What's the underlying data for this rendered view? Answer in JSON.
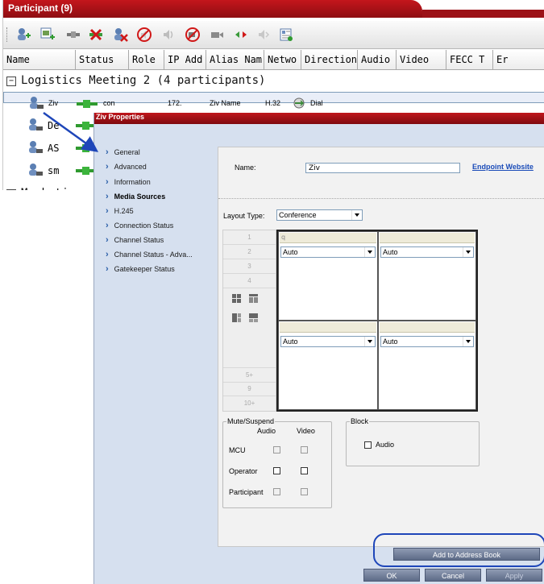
{
  "participant_panel": {
    "title": "Participant (9)",
    "toolbar_icons": [
      "add-participant-icon",
      "add-from-address-book-icon",
      "connect-icon",
      "disconnect-icon",
      "delete-participant-icon",
      "mute-audio-icon",
      "audio-icon",
      "block-video-icon",
      "video-icon",
      "suspend-icon",
      "speaker-icon",
      "properties-icon"
    ],
    "columns": [
      "Name",
      "Status",
      "Role",
      "IP Add",
      "Alias Nam",
      "Netwo",
      "Direction",
      "Audio",
      "Video",
      "FECC T",
      "Er"
    ],
    "groups": [
      {
        "toggle": "−",
        "label": "Logistics Meeting 2 (4 participants)"
      },
      {
        "toggle": "−",
        "label": "Marketing_"
      }
    ],
    "rows": [
      {
        "name": "Ziv",
        "role": "con",
        "ip": "172.",
        "alias": "Ziv Name",
        "network": "H.32",
        "direction": "Dial"
      },
      {
        "name": "De",
        "role": "",
        "ip": "",
        "alias": "",
        "network": "",
        "direction": ""
      },
      {
        "name": "AS",
        "role": "",
        "ip": "",
        "alias": "",
        "network": "",
        "direction": ""
      },
      {
        "name": "sm",
        "role": "",
        "ip": "",
        "alias": "",
        "network": "",
        "direction": ""
      }
    ]
  },
  "dialog": {
    "title": "Ziv Properties",
    "nav": [
      "General",
      "Advanced",
      "Information",
      "Media Sources",
      "H.245",
      "Connection Status",
      "Channel Status",
      "Channel Status - Adva...",
      "Gatekeeper Status"
    ],
    "active_nav": "Media Sources",
    "name_label": "Name:",
    "name_value": "Ziv",
    "endpoint_link": "Endpoint Website",
    "layout_type_label": "Layout Type:",
    "layout_type_value": "Conference",
    "layout_numbers": [
      "1",
      "2",
      "3",
      "4",
      "5+",
      "9",
      "10+"
    ],
    "cell_top_left_head": "q",
    "cell_options": [
      "Auto",
      "Auto",
      "Auto",
      "Auto"
    ],
    "mute_suspend": {
      "legend": "Mute/Suspend",
      "audio_label": "Audio",
      "video_label": "Video",
      "rows": [
        "MCU",
        "Operator",
        "Participant"
      ]
    },
    "block": {
      "legend": "Block",
      "audio_label": "Audio"
    },
    "buttons": {
      "add_to_address_book": "Add to Address Book",
      "ok": "OK",
      "cancel": "Cancel",
      "apply": "Apply"
    }
  },
  "colors": {
    "title_red": "#c4161c",
    "dialog_bg": "#d6e0ef",
    "button_blue": "#6b7893",
    "annotation_blue": "#1e46b9"
  }
}
